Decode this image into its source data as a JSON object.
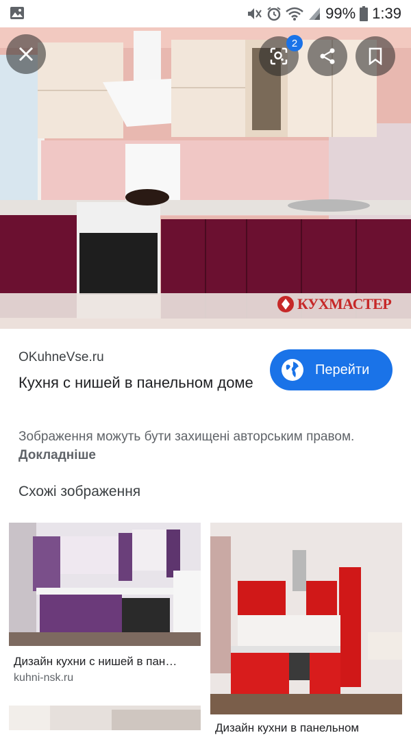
{
  "status_bar": {
    "battery": "99%",
    "time": "1:39"
  },
  "viewer": {
    "lens_badge_count": "2",
    "watermark_brand": "КУХМАСТЕР"
  },
  "result": {
    "source": "OKuhneVse.ru",
    "title": "Кухня с нишей в панельном доме",
    "visit_button": "Перейти",
    "copyright_notice": "Зображення можуть бути захищені авторським правом.",
    "learn_more": "Докладніше"
  },
  "similar": {
    "heading": "Схожі зображення",
    "items": [
      {
        "caption": "Дизайн кухни с нишей в пан…",
        "source": "kuhni-nsk.ru"
      },
      {
        "caption": "Дизайн кухни в панельном"
      }
    ]
  },
  "colors": {
    "accent": "#1a73e8",
    "cabinet_burgundy": "#6b1030",
    "brand_red": "#c62828"
  }
}
